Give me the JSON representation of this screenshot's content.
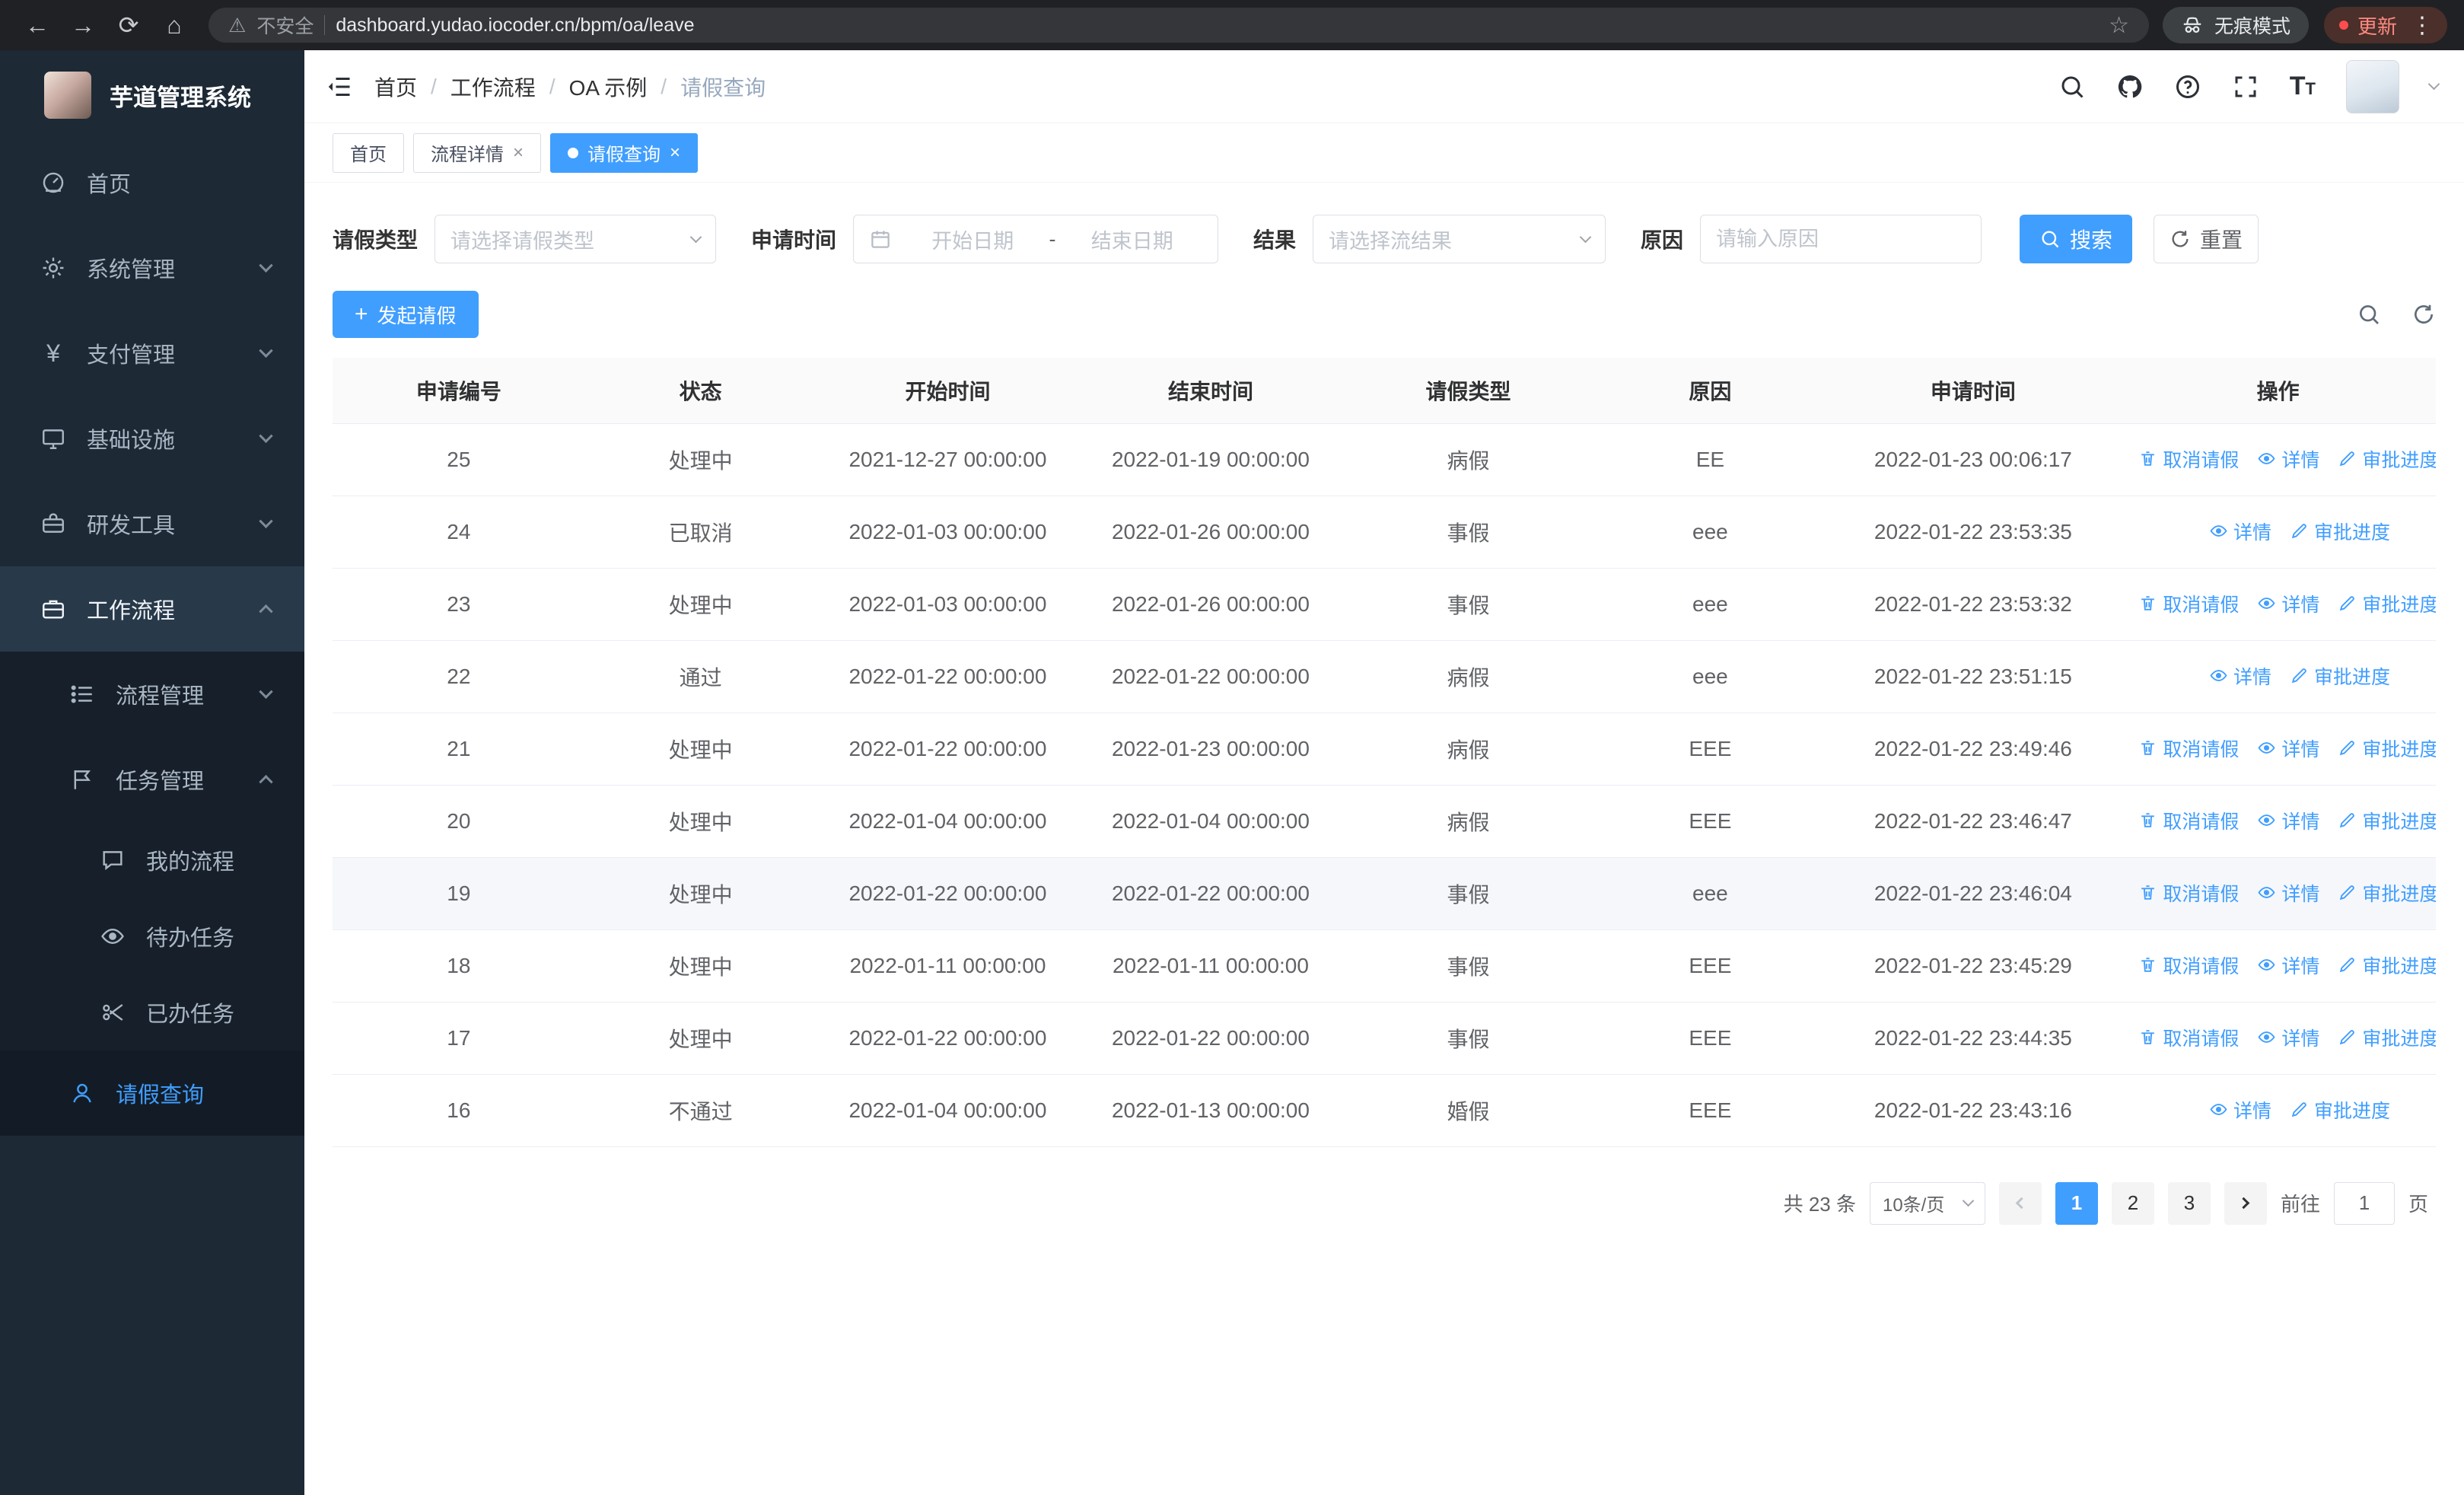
{
  "colors": {
    "accent": "#409eff",
    "chrome_bg": "#202124",
    "sidebar_bg": "#1d2935"
  },
  "browser": {
    "nav": {
      "back": "←",
      "forward": "→",
      "reload": "⟳",
      "home": "⌂"
    },
    "warning_glyph": "⚠",
    "security_label": "不安全",
    "url": "dashboard.yudao.iocoder.cn/bpm/oa/leave",
    "star_glyph": "☆",
    "incognito_label": "无痕模式",
    "update_label": "更新",
    "kebab_glyph": "⋮"
  },
  "sidebar": {
    "title": "芋道管理系统",
    "payment_glyph": "¥",
    "items": [
      {
        "label": "首页"
      },
      {
        "label": "系统管理"
      },
      {
        "label": "支付管理"
      },
      {
        "label": "基础设施"
      },
      {
        "label": "研发工具"
      },
      {
        "label": "工作流程"
      }
    ],
    "sub_items": [
      {
        "label": "流程管理"
      },
      {
        "label": "任务管理"
      }
    ],
    "task_items": [
      {
        "label": "我的流程"
      },
      {
        "label": "待办任务"
      },
      {
        "label": "已办任务"
      }
    ],
    "active_item": "请假查询"
  },
  "header": {
    "crumbs": [
      "首页",
      "工作流程",
      "OA 示例",
      "请假查询"
    ],
    "separator": "/",
    "help_glyph": "?",
    "font_glyph": "T"
  },
  "tabbar": {
    "close_glyph": "×",
    "tabs": [
      {
        "label": "首页"
      },
      {
        "label": "流程详情"
      },
      {
        "label": "请假查询"
      }
    ]
  },
  "filters": {
    "leave_type_label": "请假类型",
    "leave_type_placeholder": "请选择请假类型",
    "apply_time_label": "申请时间",
    "start_date_placeholder": "开始日期",
    "range_separator": "-",
    "end_date_placeholder": "结束日期",
    "result_label": "结果",
    "result_placeholder": "请选择流结果",
    "reason_label": "原因",
    "reason_placeholder": "请输入原因",
    "search_button": "搜索",
    "reset_button": "重置"
  },
  "toolbar": {
    "create_button": "发起请假",
    "plus_glyph": "+"
  },
  "table": {
    "columns": [
      "申请编号",
      "状态",
      "开始时间",
      "结束时间",
      "请假类型",
      "原因",
      "申请时间",
      "操作"
    ],
    "op_labels": {
      "cancel": "取消请假",
      "detail": "详情",
      "progress": "审批进度"
    },
    "rows": [
      {
        "id": "25",
        "status": "处理中",
        "start": "2021-12-27 00:00:00",
        "end": "2022-01-19 00:00:00",
        "type": "病假",
        "reason": "EE",
        "apply": "2022-01-23 00:06:17",
        "ops": [
          "cancel",
          "detail",
          "progress"
        ]
      },
      {
        "id": "24",
        "status": "已取消",
        "start": "2022-01-03 00:00:00",
        "end": "2022-01-26 00:00:00",
        "type": "事假",
        "reason": "eee",
        "apply": "2022-01-22 23:53:35",
        "ops": [
          "detail",
          "progress"
        ]
      },
      {
        "id": "23",
        "status": "处理中",
        "start": "2022-01-03 00:00:00",
        "end": "2022-01-26 00:00:00",
        "type": "事假",
        "reason": "eee",
        "apply": "2022-01-22 23:53:32",
        "ops": [
          "cancel",
          "detail",
          "progress"
        ]
      },
      {
        "id": "22",
        "status": "通过",
        "start": "2022-01-22 00:00:00",
        "end": "2022-01-22 00:00:00",
        "type": "病假",
        "reason": "eee",
        "apply": "2022-01-22 23:51:15",
        "ops": [
          "detail",
          "progress"
        ]
      },
      {
        "id": "21",
        "status": "处理中",
        "start": "2022-01-22 00:00:00",
        "end": "2022-01-23 00:00:00",
        "type": "病假",
        "reason": "EEE",
        "apply": "2022-01-22 23:49:46",
        "ops": [
          "cancel",
          "detail",
          "progress"
        ]
      },
      {
        "id": "20",
        "status": "处理中",
        "start": "2022-01-04 00:00:00",
        "end": "2022-01-04 00:00:00",
        "type": "病假",
        "reason": "EEE",
        "apply": "2022-01-22 23:46:47",
        "ops": [
          "cancel",
          "detail",
          "progress"
        ]
      },
      {
        "id": "19",
        "status": "处理中",
        "start": "2022-01-22 00:00:00",
        "end": "2022-01-22 00:00:00",
        "type": "事假",
        "reason": "eee",
        "apply": "2022-01-22 23:46:04",
        "ops": [
          "cancel",
          "detail",
          "progress"
        ],
        "hover": true
      },
      {
        "id": "18",
        "status": "处理中",
        "start": "2022-01-11 00:00:00",
        "end": "2022-01-11 00:00:00",
        "type": "事假",
        "reason": "EEE",
        "apply": "2022-01-22 23:45:29",
        "ops": [
          "cancel",
          "detail",
          "progress"
        ]
      },
      {
        "id": "17",
        "status": "处理中",
        "start": "2022-01-22 00:00:00",
        "end": "2022-01-22 00:00:00",
        "type": "事假",
        "reason": "EEE",
        "apply": "2022-01-22 23:44:35",
        "ops": [
          "cancel",
          "detail",
          "progress"
        ]
      },
      {
        "id": "16",
        "status": "不通过",
        "start": "2022-01-04 00:00:00",
        "end": "2022-01-13 00:00:00",
        "type": "婚假",
        "reason": "EEE",
        "apply": "2022-01-22 23:43:16",
        "ops": [
          "detail",
          "progress"
        ]
      }
    ]
  },
  "pagination": {
    "total": "共 23 条",
    "page_size": "10条/页",
    "pages": [
      "1",
      "2",
      "3"
    ],
    "goto_label": "前往",
    "goto_value": "1",
    "goto_suffix": "页"
  }
}
